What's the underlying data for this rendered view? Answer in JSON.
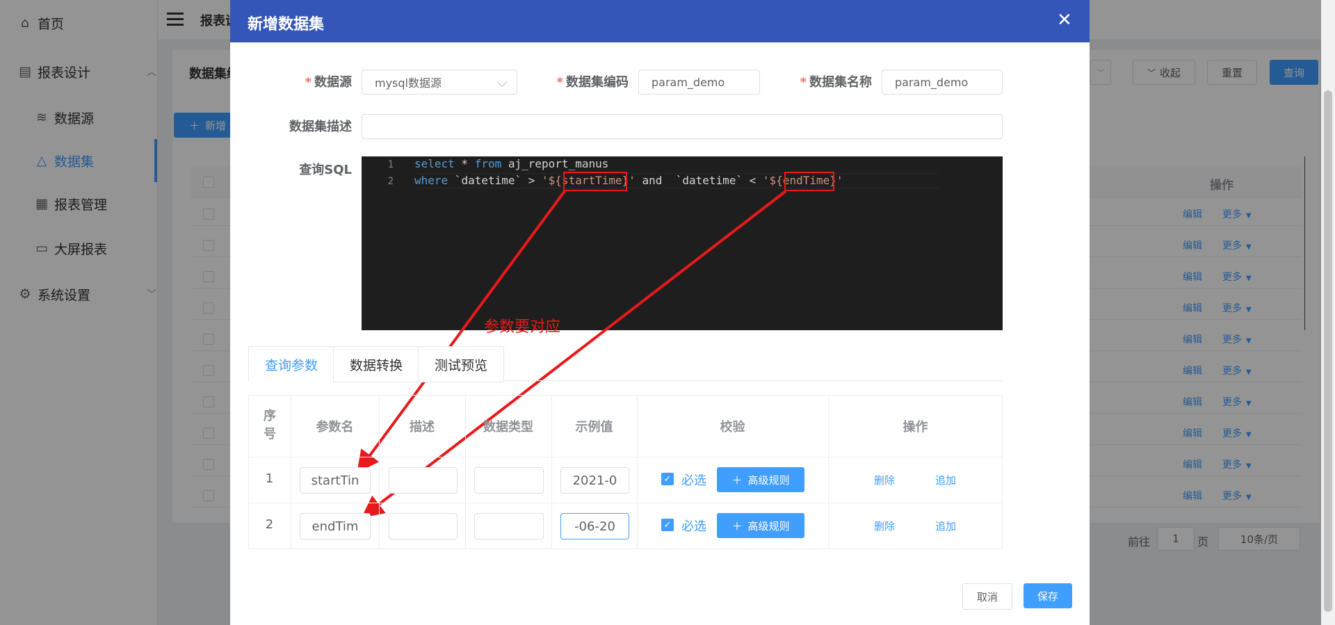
{
  "sidebar": {
    "items": [
      {
        "label": "首页",
        "icon": "home-icon"
      },
      {
        "label": "报表设计",
        "icon": "report-design-icon"
      },
      {
        "label": "数据源",
        "icon": "database-icon"
      },
      {
        "label": "数据集",
        "icon": "dataset-icon"
      },
      {
        "label": "报表管理",
        "icon": "report-manage-icon"
      },
      {
        "label": "大屏报表",
        "icon": "screen-icon"
      },
      {
        "label": "系统设置",
        "icon": "gear-icon"
      }
    ]
  },
  "header": {
    "breadcrumb": "报表设"
  },
  "background": {
    "filter_label": "数据集编",
    "new_button": "新增",
    "collapse_button": "收起",
    "reset_button": "重置",
    "query_button": "查询",
    "op_header": "操作",
    "row_edit": "编辑",
    "row_more": "更多",
    "pager_goto": "前往",
    "pager_page": "1",
    "pager_page_unit": "页",
    "pager_size": "10条/页"
  },
  "dialog": {
    "title": "新增数据集",
    "fields": {
      "datasource_label": "数据源",
      "datasource_value": "mysql数据源",
      "code_label": "数据集编码",
      "code_value": "param_demo",
      "name_label": "数据集名称",
      "name_value": "param_demo",
      "desc_label": "数据集描述",
      "desc_value": "",
      "sql_label": "查询SQL"
    },
    "sql": {
      "line1_no": "1",
      "line2_no": "2",
      "l1_kw1": "select",
      "l1_p1": " * ",
      "l1_kw2": "from",
      "l1_p2": " aj_report_manus",
      "l2_kw1": "where",
      "l2_p1": " `datetime` > ",
      "l2_s1": "'${startTime}'",
      "l2_p2": " and  `datetime` < ",
      "l2_s2": "'${endTime}'"
    },
    "annotation": "参数要对应",
    "tabs": [
      "查询参数",
      "数据转换",
      "测试预览"
    ],
    "param_table": {
      "headers": {
        "index": "序号",
        "name": "参数名",
        "desc": "描述",
        "type": "数据类型",
        "sample": "示例值",
        "check": "校验",
        "op": "操作"
      },
      "rows": [
        {
          "index": "1",
          "name": "startTin",
          "desc": "",
          "type": "",
          "sample": "2021-0",
          "required": "必选",
          "rule": "高级规则",
          "delete": "删除",
          "append": "追加"
        },
        {
          "index": "2",
          "name": "endTim",
          "desc": "",
          "type": "",
          "sample": "-06-20",
          "required": "必选",
          "rule": "高级规则",
          "delete": "删除",
          "append": "追加"
        }
      ]
    },
    "footer": {
      "cancel": "取消",
      "save": "保存"
    },
    "colors": {
      "header_bg": "#3456b8",
      "primary": "#409eff",
      "annotation": "#e8191a"
    }
  }
}
